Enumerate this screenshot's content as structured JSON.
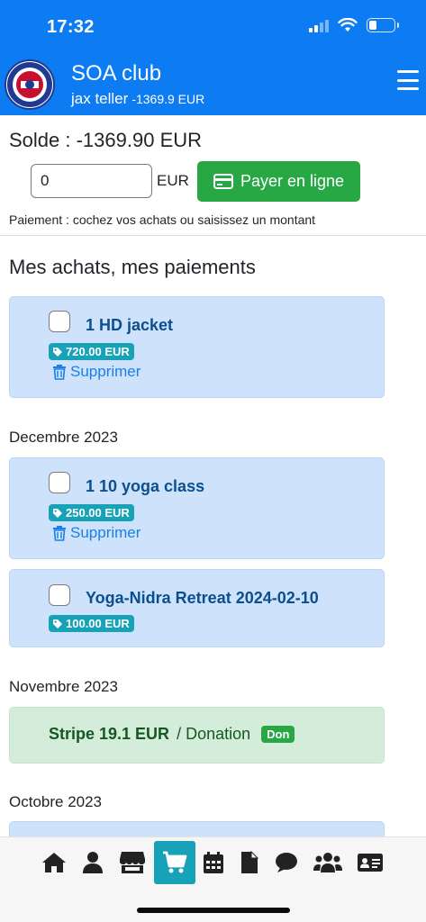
{
  "status_bar": {
    "time": "17:32"
  },
  "header": {
    "club_name": "SOA club",
    "user_name": "jax teller",
    "user_balance": "-1369.9 EUR",
    "icons": {
      "logo": "club-logo",
      "menu": "hamburger-menu-icon"
    }
  },
  "balance": {
    "label": "Solde : -1369.90 EUR",
    "amount_value": "0",
    "currency": "EUR",
    "pay_button": "Payer en ligne",
    "hint": "Paiement : cochez vos achats ou saisissez un montant"
  },
  "section_title": "Mes achats, mes paiements",
  "groups": [
    {
      "month": "",
      "items": [
        {
          "title": "1 HD jacket",
          "price": "720.00 EUR",
          "delete": "Supprimer"
        }
      ]
    },
    {
      "month": "Decembre 2023",
      "items": [
        {
          "title": "1 10 yoga class",
          "price": "250.00 EUR",
          "delete": "Supprimer"
        },
        {
          "title": "Yoga-Nidra Retreat 2024-02-10",
          "price": "100.00 EUR"
        }
      ]
    },
    {
      "month": "Novembre 2023",
      "payments": [
        {
          "title": "Stripe 19.1 EUR",
          "type": "/ Donation",
          "badge": "Don"
        }
      ]
    },
    {
      "month": "Octobre 2023"
    }
  ],
  "bottom_nav": [
    "home-icon",
    "user-icon",
    "store-icon",
    "cart-icon",
    "calendar-icon",
    "document-icon",
    "chat-icon",
    "users-icon",
    "id-card-icon"
  ],
  "colors": {
    "primary": "#0d7bf2",
    "success": "#28a745",
    "info": "#17a2b8",
    "card_blue": "#cfe2fb",
    "card_green": "#d4edda",
    "link": "#1a7fe6"
  }
}
